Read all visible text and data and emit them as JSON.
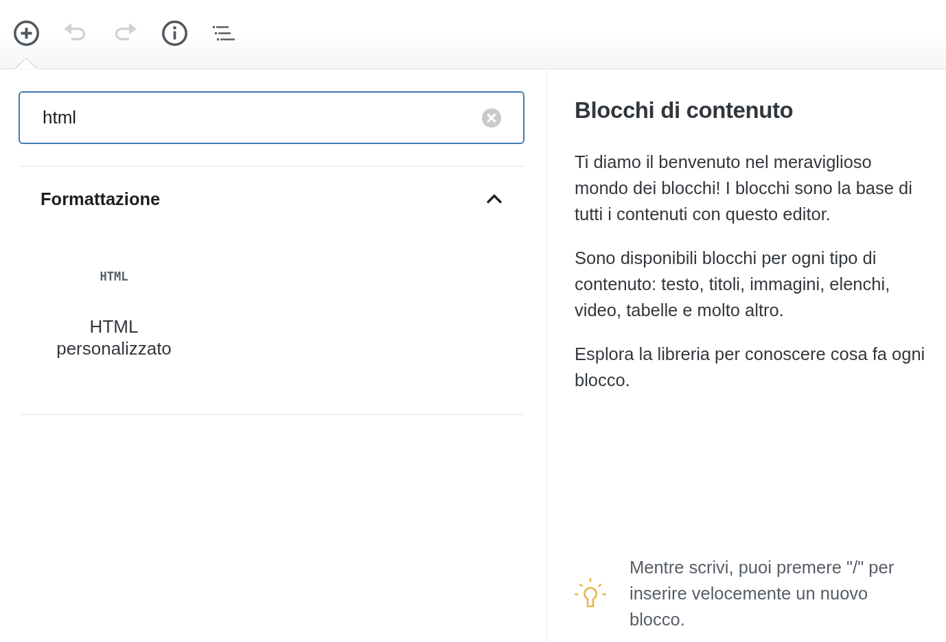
{
  "toolbar": {
    "tools": [
      {
        "kind": "add",
        "expanded": true,
        "disabled": false
      },
      {
        "kind": "undo",
        "expanded": false,
        "disabled": true
      },
      {
        "kind": "redo",
        "expanded": false,
        "disabled": true
      },
      {
        "kind": "info",
        "expanded": false,
        "disabled": false
      },
      {
        "kind": "outline",
        "expanded": false,
        "disabled": false
      }
    ]
  },
  "inserter": {
    "search": {
      "value": "html"
    },
    "panels": [
      {
        "title": "Formattazione",
        "expanded": true,
        "blocks": [
          {
            "icon_text": "HTML",
            "label": "HTML personalizzato"
          }
        ]
      }
    ]
  },
  "help": {
    "title": "Blocchi di contenuto",
    "paragraphs": [
      "Ti diamo il benvenuto nel meraviglioso mondo dei blocchi! I blocchi sono la base di tutti i contenuti con questo editor.",
      "Sono disponibili blocchi per ogni tipo di contenuto: testo, titoli, immagini, elenchi, video, tabelle e molto altro.",
      "Esplora la libreria per conoscere cosa fa ogni blocco."
    ],
    "tip": "Mentre scrivi, puoi premere \"/\" per inserire velocemente un nuovo blocco."
  }
}
